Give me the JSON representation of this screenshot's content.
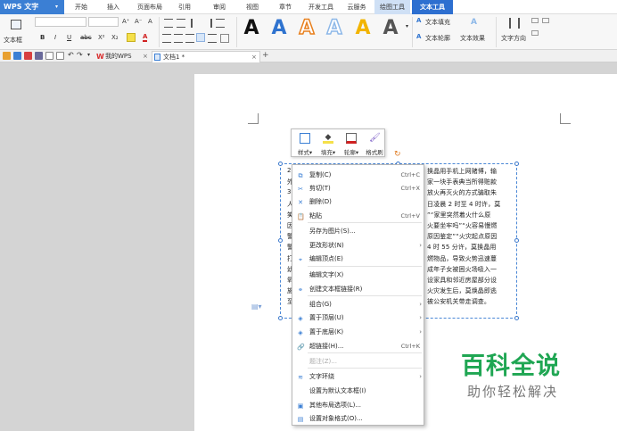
{
  "app": {
    "title": "WPS 文字"
  },
  "menubar": {
    "items": [
      "开始",
      "插入",
      "页面布局",
      "引用",
      "审阅",
      "视图",
      "章节",
      "开发工具",
      "云服务",
      "绘图工具",
      "文本工具"
    ],
    "highlighted": "绘图工具",
    "active": "文本工具"
  },
  "ribbon": {
    "textbox_label": "文本框",
    "text_fill": "文本填充",
    "text_outline": "文本轮廓",
    "text_effects": "文本效果",
    "text_direction": "文字方向",
    "bold": "B",
    "italic": "I",
    "underline": "U",
    "strike": "abc",
    "superscript": "X²",
    "subscript": "X₂",
    "grow_font": "A⁺",
    "shrink_font": "A⁻",
    "clear": "A",
    "font_color": "A",
    "style_A": "A",
    "style_colors": [
      "#111111",
      "#2f73cf",
      "#e8801e",
      "#8db8e8",
      "#f2b400",
      "#555555"
    ]
  },
  "tabs": {
    "home": "我的WPS",
    "doc": "文档1 *",
    "close": "×",
    "add": "+"
  },
  "textbox": {
    "lines": [
      {
        "left": "2",
        "right": "换晶用手机上网赌博，输"
      },
      {
        "left": "外",
        "right": "家一块手表典当所得赃款"
      },
      {
        "left": "3",
        "right": "放火再灭火的方式骗取朱"
      },
      {
        "left": "人",
        "right": "日凌晨 2 时至 4 时许，莫"
      },
      {
        "left": "笑",
        "right": "”“家里突然着火什么原"
      },
      {
        "left": "因",
        "right": "火要坐牢吗”“火容易慢燃"
      },
      {
        "left": "警",
        "right": "原因鉴定”“火灾起点原因"
      },
      {
        "left": "警",
        "right": "4 时 55 分许，莫换晶用"
      },
      {
        "left": "打",
        "right": "燃物品，导致火势迅速蔓"
      },
      {
        "left": "幼",
        "right": "成年子女被困火场吸入一"
      },
      {
        "left": "氧",
        "right": "设家具和邻近房屋部分设"
      },
      {
        "left": "施",
        "right": "火灾发生后，莫焕晶即逃"
      },
      {
        "left": "至",
        "right": "被公安机关带走调查。"
      }
    ]
  },
  "minitoolbar": {
    "items": [
      {
        "label": "样式",
        "caret": "▾"
      },
      {
        "label": "填充",
        "caret": "▾"
      },
      {
        "label": "轮廓",
        "caret": "▾"
      },
      {
        "label": "格式刷",
        "caret": ""
      }
    ]
  },
  "contextmenu": {
    "items": [
      {
        "label": "复制(C)",
        "shortcut": "Ctrl+C",
        "icon": "copy-icon",
        "glyph": "⧉",
        "arrow": ""
      },
      {
        "label": "剪切(T)",
        "shortcut": "Ctrl+X",
        "icon": "cut-icon",
        "glyph": "✂",
        "arrow": ""
      },
      {
        "label": "删除(D)",
        "shortcut": "",
        "icon": "delete-icon",
        "glyph": "✕",
        "arrow": ""
      },
      {
        "label": "粘贴",
        "shortcut": "Ctrl+V",
        "icon": "paste-icon",
        "glyph": "📋",
        "arrow": ""
      },
      {
        "label": "另存为图片(S)...",
        "shortcut": "",
        "icon": "",
        "glyph": "",
        "arrow": ""
      },
      {
        "label": "更改形状(N)",
        "shortcut": "",
        "icon": "",
        "glyph": "",
        "arrow": "›"
      },
      {
        "label": "编辑顶点(E)",
        "shortcut": "",
        "icon": "edit-points-icon",
        "glyph": "⌖",
        "arrow": ""
      },
      {
        "label": "编辑文字(X)",
        "shortcut": "",
        "icon": "",
        "glyph": "",
        "arrow": ""
      },
      {
        "label": "创建文本框链接(R)",
        "shortcut": "",
        "icon": "link-textbox-icon",
        "glyph": "⚭",
        "arrow": ""
      },
      {
        "label": "组合(G)",
        "shortcut": "",
        "icon": "",
        "glyph": "",
        "arrow": "›"
      },
      {
        "label": "置于顶层(U)",
        "shortcut": "",
        "icon": "bring-front-icon",
        "glyph": "◈",
        "arrow": "›"
      },
      {
        "label": "置于底层(K)",
        "shortcut": "",
        "icon": "send-back-icon",
        "glyph": "◈",
        "arrow": "›"
      },
      {
        "label": "超链接(H)...",
        "shortcut": "Ctrl+K",
        "icon": "hyperlink-icon",
        "glyph": "🔗",
        "arrow": ""
      },
      {
        "label": "题注(Z)...",
        "shortcut": "",
        "icon": "",
        "glyph": "",
        "arrow": "",
        "disabled": true
      },
      {
        "label": "文字环绕",
        "shortcut": "",
        "icon": "text-wrap-icon",
        "glyph": "≋",
        "arrow": "›"
      },
      {
        "label": "设置为默认文本框(I)",
        "shortcut": "",
        "icon": "",
        "glyph": "",
        "arrow": ""
      },
      {
        "label": "其他布局选项(L)...",
        "shortcut": "",
        "icon": "layout-options-icon",
        "glyph": "▣",
        "arrow": ""
      },
      {
        "label": "设置对象格式(O)...",
        "shortcut": "",
        "icon": "format-object-icon",
        "glyph": "▤",
        "arrow": ""
      }
    ]
  },
  "watermark": {
    "title": "百科全说",
    "subtitle": "助你轻松解决"
  }
}
